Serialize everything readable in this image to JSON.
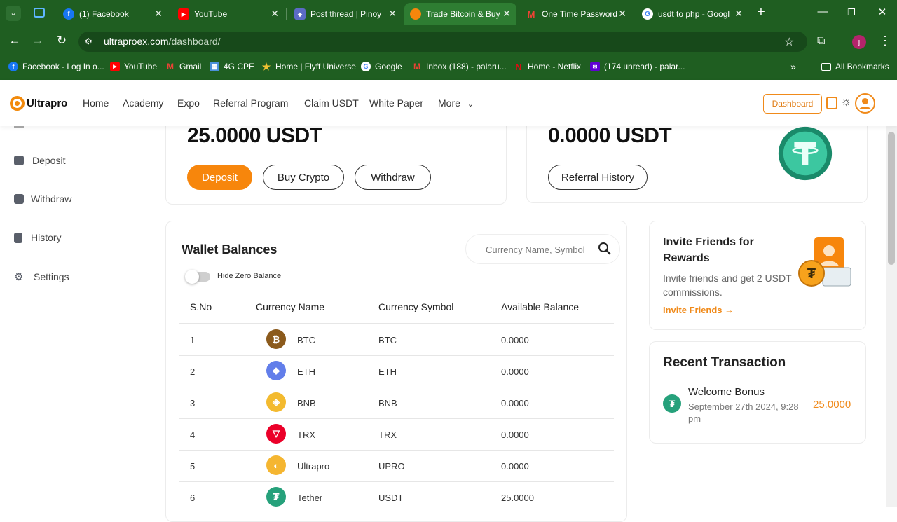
{
  "browser": {
    "tabs": [
      {
        "label": "(1) Facebook",
        "icon": "facebook-icon",
        "color": "#1877f2"
      },
      {
        "label": "YouTube",
        "icon": "youtube-icon",
        "color": "#ff0000"
      },
      {
        "label": "Post thread | Pinoy",
        "icon": "pinoy-icon",
        "color": "#5b6bc4"
      },
      {
        "label": "Trade Bitcoin & Buy",
        "icon": "ultrapro-icon",
        "color": "#f7860c"
      },
      {
        "label": "One Time Password",
        "icon": "gmail-icon",
        "color": "#ea4335"
      },
      {
        "label": "usdt to php - Googl",
        "icon": "google-icon",
        "color": "#ffffff"
      }
    ],
    "url_main": "ultraproex.com",
    "url_path": "/dashboard/",
    "bookmarks": [
      {
        "label": "Facebook - Log In o...",
        "icon": "facebook-icon",
        "color": "#1877f2"
      },
      {
        "label": "YouTube",
        "icon": "youtube-icon",
        "color": "#ff0000"
      },
      {
        "label": "Gmail",
        "icon": "gmail-icon",
        "color": "#ea4335"
      },
      {
        "label": "4G CPE",
        "icon": "globe-icon",
        "color": "#4a90d9"
      },
      {
        "label": "Home | Flyff Universe",
        "icon": "star-icon",
        "color": "#f1c232"
      },
      {
        "label": "Google",
        "icon": "google-icon",
        "color": "#ffffff"
      },
      {
        "label": "Inbox (188) - palaru...",
        "icon": "gmail-icon",
        "color": "#ea4335"
      },
      {
        "label": "Home - Netflix",
        "icon": "netflix-icon",
        "color": "#e50914"
      },
      {
        "label": "(174 unread) - palar...",
        "icon": "yahoo-icon",
        "color": "#6001d2"
      }
    ],
    "all_bookmarks": "All Bookmarks"
  },
  "header": {
    "logo_text": "Ultrapro",
    "nav": [
      "Home",
      "Academy",
      "Expo",
      "Referral Program",
      "Claim USDT",
      "White Paper",
      "More"
    ],
    "dashboard_label": "Dashboard"
  },
  "sidebar": {
    "items": [
      {
        "label": "Deposit",
        "icon": "deposit-icon"
      },
      {
        "label": "Withdraw",
        "icon": "withdraw-icon"
      },
      {
        "label": "History",
        "icon": "history-icon"
      },
      {
        "label": "Settings",
        "icon": "settings-icon"
      }
    ]
  },
  "balance_card": {
    "amount": "25.0000 USDT",
    "deposit": "Deposit",
    "buy_crypto": "Buy Crypto",
    "withdraw": "Withdraw"
  },
  "referral_card": {
    "amount": "0.0000 USDT",
    "history": "Referral History"
  },
  "wallet": {
    "title": "Wallet Balances",
    "search_placeholder": "Currency Name, Symbol",
    "hide_zero": "Hide Zero Balance",
    "columns": [
      "S.No",
      "Currency Name",
      "Currency Symbol",
      "Available Balance"
    ],
    "rows": [
      {
        "sno": "1",
        "name": "BTC",
        "symbol": "BTC",
        "balance": "0.0000",
        "color": "#8b5a1c"
      },
      {
        "sno": "2",
        "name": "ETH",
        "symbol": "ETH",
        "balance": "0.0000",
        "color": "#627eea"
      },
      {
        "sno": "3",
        "name": "BNB",
        "symbol": "BNB",
        "balance": "0.0000",
        "color": "#f3ba2f"
      },
      {
        "sno": "4",
        "name": "TRX",
        "symbol": "TRX",
        "balance": "0.0000",
        "color": "#eb0029"
      },
      {
        "sno": "5",
        "name": "Ultrapro",
        "symbol": "UPRO",
        "balance": "0.0000",
        "color": "#f5b631"
      },
      {
        "sno": "6",
        "name": "Tether",
        "symbol": "USDT",
        "balance": "25.0000",
        "color": "#26a17b"
      }
    ]
  },
  "invite": {
    "title": "Invite Friends for Rewards",
    "text": "Invite friends and get 2 USDT commissions.",
    "link": "Invite Friends →"
  },
  "recent": {
    "title": "Recent Transaction",
    "item_title": "Welcome Bonus",
    "item_date": "September 27th 2024, 9:28 pm",
    "item_amount": "25.0000"
  },
  "colors": {
    "accent": "#f7860c",
    "browser_green": "#1f5e21",
    "tether": "#26a17b"
  }
}
